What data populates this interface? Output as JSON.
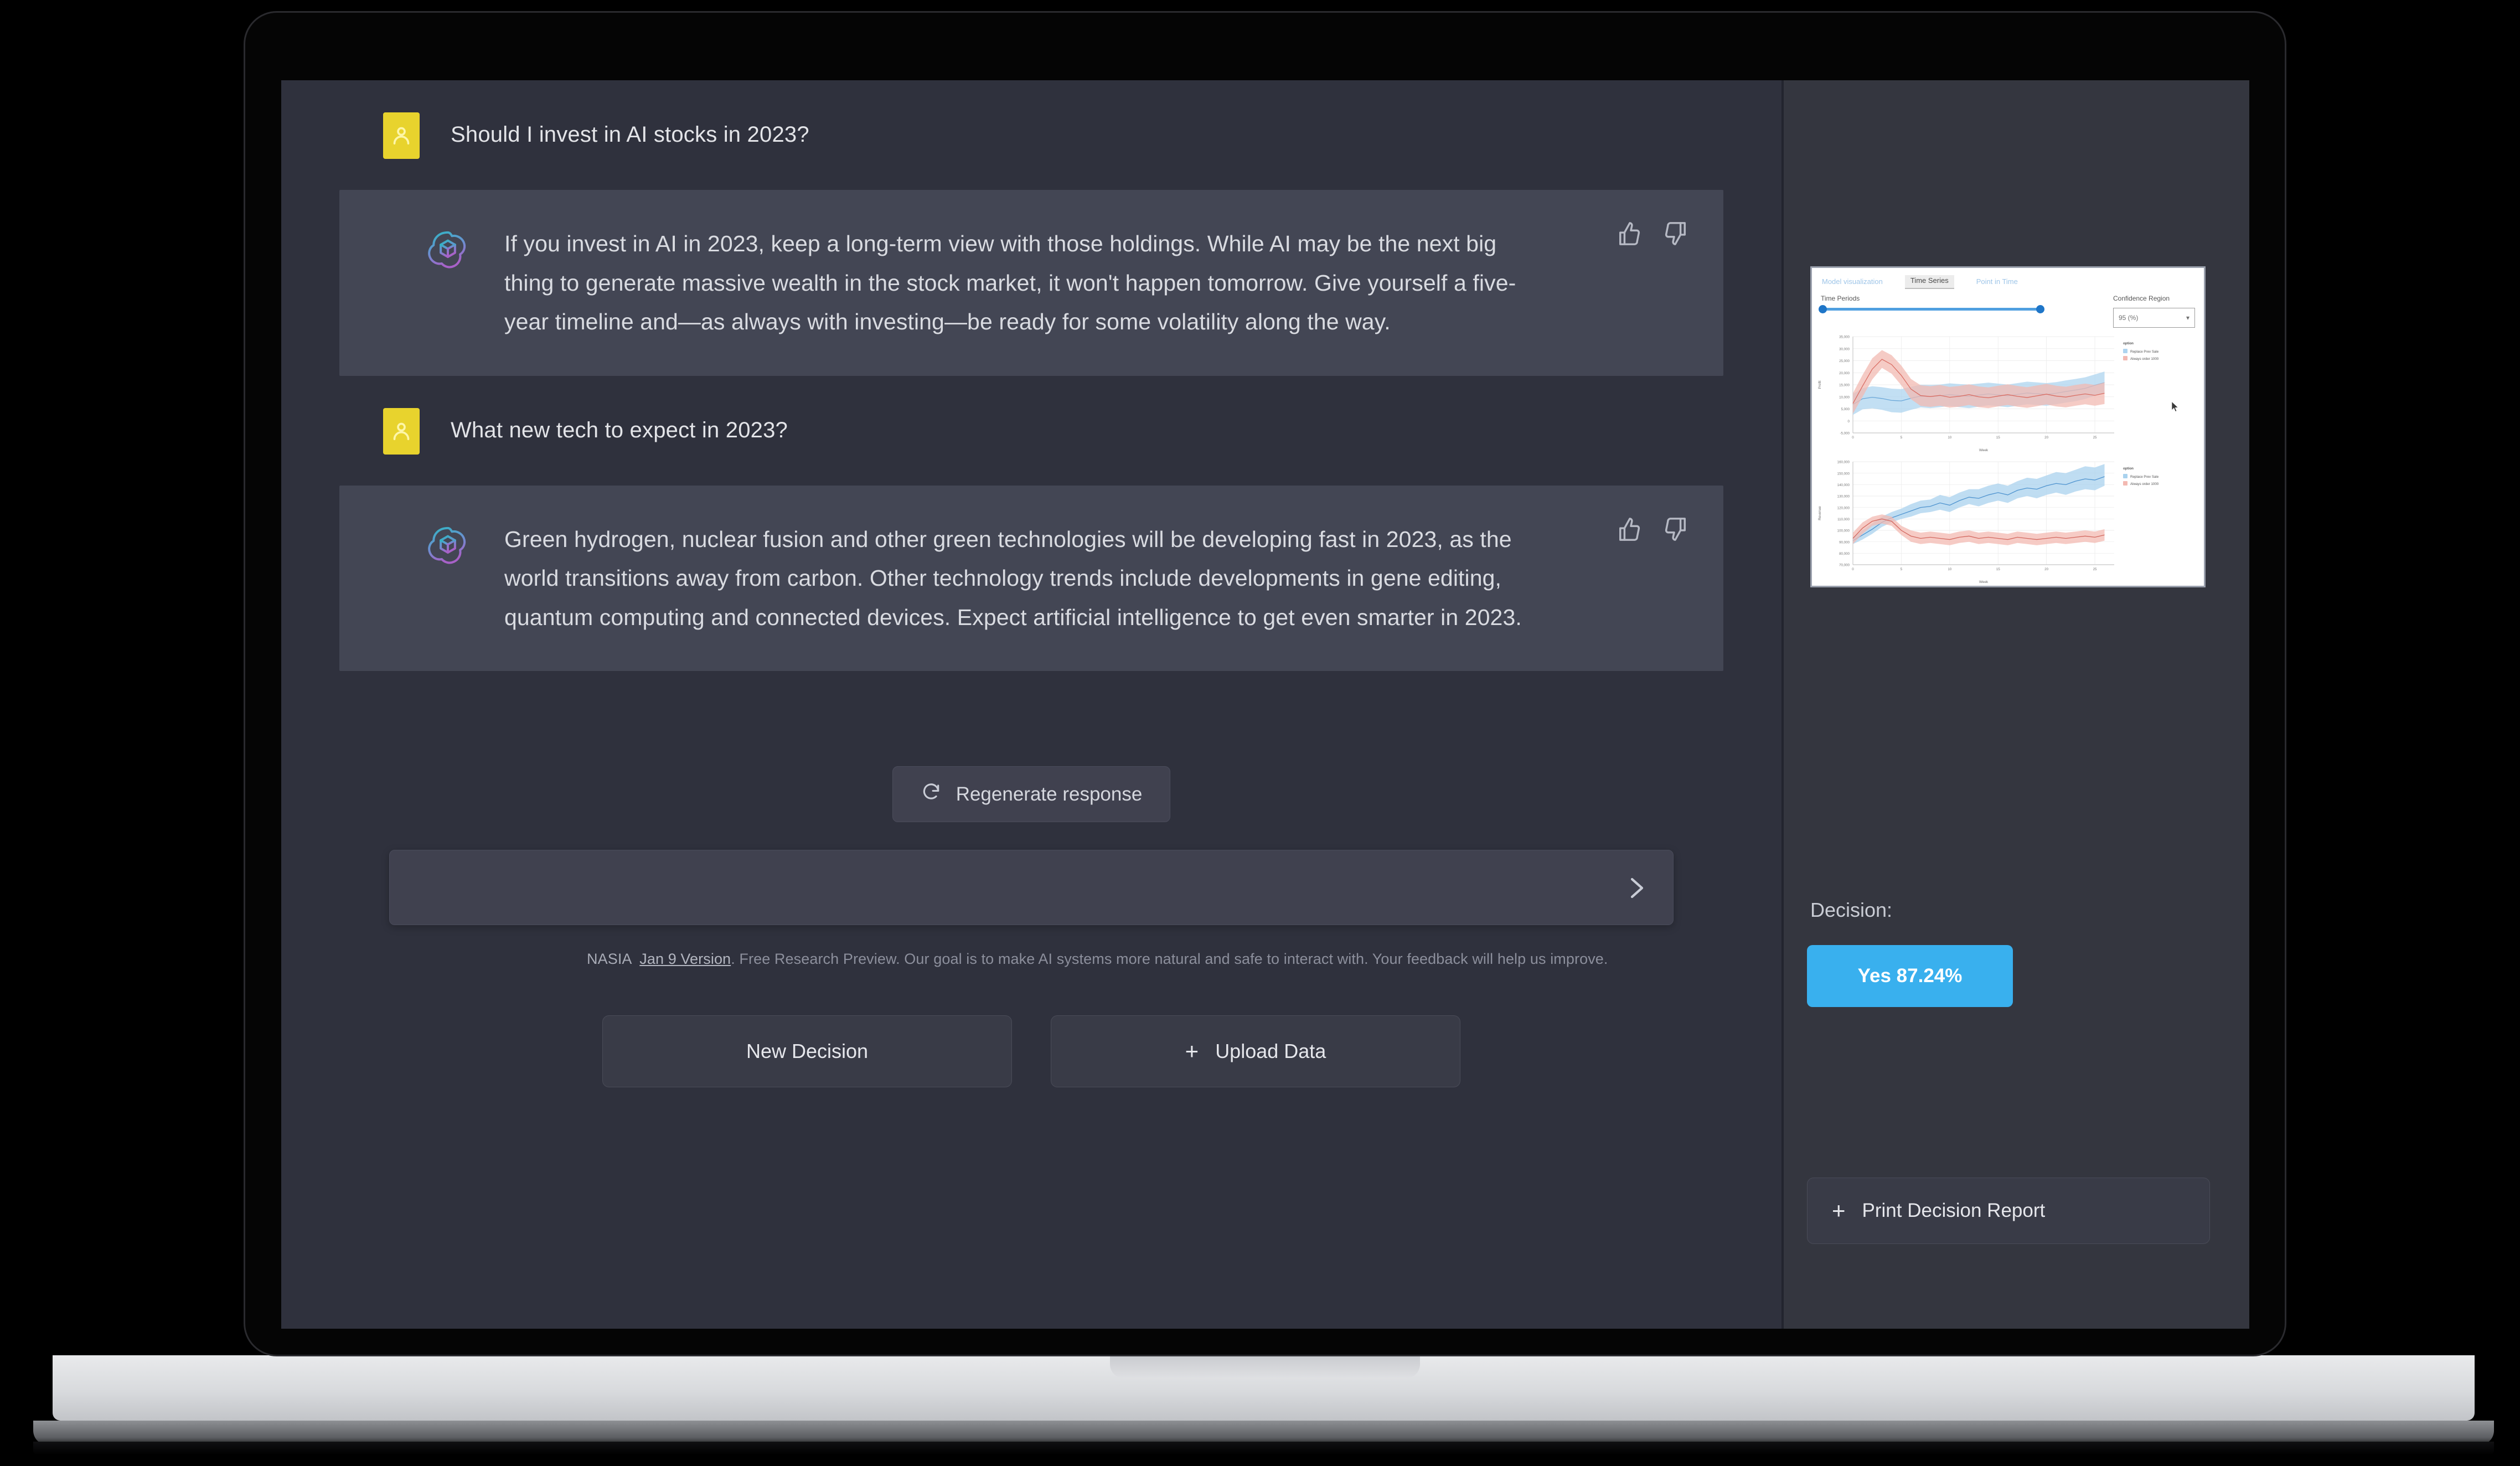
{
  "chat": {
    "messages": [
      {
        "role": "user",
        "avatar_icon": "person-icon",
        "text": "Should I invest in AI stocks in 2023?"
      },
      {
        "role": "assistant",
        "avatar_icon": "openai-logo-icon",
        "text": "If you invest in AI in 2023, keep a long-term view with those holdings. While AI may be the next big thing to generate massive wealth in the stock market, it won't happen tomorrow. Give yourself a five-year timeline and—as always with investing—be ready for some volatility along the way.",
        "thumbs_up_icon": "thumbs-up-icon",
        "thumbs_down_icon": "thumbs-down-icon"
      },
      {
        "role": "user",
        "avatar_icon": "person-icon",
        "text": "What new tech to expect in 2023?"
      },
      {
        "role": "assistant",
        "avatar_icon": "openai-logo-icon",
        "text": "Green hydrogen, nuclear fusion and other green technologies will be developing fast in 2023, as the world transitions away from carbon. Other technology trends include developments in gene editing, quantum computing and connected devices. Expect artificial intelligence to get even smarter in 2023.",
        "thumbs_up_icon": "thumbs-up-icon",
        "thumbs_down_icon": "thumbs-down-icon"
      }
    ],
    "regenerate_label": "Regenerate response",
    "regenerate_icon": "refresh-icon",
    "input_value": "",
    "input_placeholder": "",
    "send_icon": "send-icon"
  },
  "footer": {
    "brand": "NASIA",
    "version": "Jan 9 Version",
    "notice": ". Free Research Preview. Our goal is to make AI systems more natural and safe to interact with. Your feedback will help us improve."
  },
  "bottom_buttons": [
    {
      "label": "New Decision",
      "icon": ""
    },
    {
      "label": "Upload Data",
      "icon": "plus-icon"
    }
  ],
  "side_panel": {
    "viz": {
      "tabs": [
        {
          "label": "Model visualization",
          "active": false
        },
        {
          "label": "Time Series",
          "active": true
        },
        {
          "label": "Point in Time",
          "active": false
        }
      ],
      "time_periods_label": "Time Periods",
      "confidence_region_label": "Confidence Region",
      "confidence_region_value": "95 (%)",
      "dropdown_icon": "chevron-down-icon"
    },
    "decision_label": "Decision:",
    "decision_value": "Yes 87.24%",
    "decision_color": "#39b0ee",
    "print_report_label": "Print Decision Report",
    "print_report_icon": "plus-icon"
  },
  "chart_data": [
    {
      "type": "line",
      "title": "",
      "xlabel": "Week",
      "ylabel": "Profit",
      "xlim": [
        0,
        27
      ],
      "ylim": [
        -5000,
        35000
      ],
      "xticks": [
        0,
        5,
        10,
        15,
        20,
        25
      ],
      "yticks": [
        -5000,
        0,
        5000,
        10000,
        15000,
        20000,
        25000,
        30000,
        35000
      ],
      "ytick_labels": [
        "-5,000",
        "0",
        "5,000",
        "10,000",
        "15,000",
        "20,000",
        "25,000",
        "30,000",
        "35,000"
      ],
      "grid": true,
      "legend_title": "option",
      "legend_position": "right",
      "series": [
        {
          "name": "Replace Prev Sale",
          "color": "#6aa7d8",
          "band_color": "#aed4ef",
          "x": [
            0,
            1,
            2,
            3,
            4,
            5,
            6,
            7,
            8,
            9,
            10,
            11,
            12,
            13,
            14,
            15,
            16,
            17,
            18,
            19,
            20,
            21,
            22,
            23,
            24,
            25,
            26
          ],
          "values": [
            6800,
            9200,
            9800,
            9300,
            8500,
            8300,
            9400,
            10300,
            10100,
            10400,
            10900,
            10500,
            10200,
            10700,
            11200,
            10800,
            10400,
            11000,
            11600,
            11300,
            11000,
            11500,
            12200,
            12800,
            13500,
            14800,
            15900
          ],
          "band_low": [
            2500,
            4800,
            5200,
            4600,
            3600,
            3400,
            4600,
            5600,
            5300,
            5700,
            6200,
            5700,
            5300,
            5900,
            6500,
            6100,
            5700,
            6300,
            6900,
            6600,
            6300,
            6900,
            7600,
            8200,
            9100,
            10500,
            11600
          ],
          "band_high": [
            11200,
            13600,
            14400,
            14000,
            13400,
            13200,
            14200,
            15000,
            14900,
            15100,
            15600,
            15300,
            15100,
            15500,
            15900,
            15500,
            15100,
            15700,
            16300,
            16000,
            15700,
            16100,
            16800,
            17400,
            18100,
            19300,
            20500
          ]
        },
        {
          "name": "Always order 1000",
          "color": "#d96d63",
          "band_color": "#f2b9b2",
          "x": [
            0,
            1,
            2,
            3,
            4,
            5,
            6,
            7,
            8,
            9,
            10,
            11,
            12,
            13,
            14,
            15,
            16,
            17,
            18,
            19,
            20,
            21,
            22,
            23,
            24,
            25,
            26
          ],
          "values": [
            7200,
            14500,
            21500,
            25600,
            23400,
            18900,
            13200,
            10500,
            10100,
            10600,
            9800,
            10200,
            10900,
            10000,
            9600,
            10300,
            10900,
            10200,
            9700,
            10400,
            11100,
            10300,
            9900,
            10600,
            11200,
            10600,
            11500
          ],
          "band_low": [
            3000,
            10000,
            17200,
            22000,
            19600,
            14800,
            9000,
            6200,
            5800,
            6300,
            5500,
            5900,
            6600,
            5700,
            5300,
            6000,
            6600,
            5900,
            5400,
            6100,
            6800,
            6000,
            5600,
            6300,
            6900,
            6300,
            7000
          ],
          "band_high": [
            11500,
            19100,
            26000,
            29400,
            27300,
            23000,
            17400,
            14800,
            14400,
            14900,
            14100,
            14500,
            15200,
            14300,
            13900,
            14600,
            15200,
            14500,
            14000,
            14700,
            15400,
            14600,
            14200,
            14900,
            15500,
            14900,
            16000
          ]
        }
      ]
    },
    {
      "type": "line",
      "title": "",
      "xlabel": "Week",
      "ylabel": "Revenue",
      "xlim": [
        0,
        27
      ],
      "ylim": [
        70000,
        160000
      ],
      "xticks": [
        0,
        5,
        10,
        15,
        20,
        25
      ],
      "yticks": [
        70000,
        80000,
        90000,
        100000,
        110000,
        120000,
        130000,
        140000,
        150000,
        160000
      ],
      "ytick_labels": [
        "70,000",
        "80,000",
        "90,000",
        "100,000",
        "110,000",
        "120,000",
        "130,000",
        "140,000",
        "150,000",
        "160,000"
      ],
      "grid": true,
      "legend_title": "option",
      "legend_position": "right",
      "series": [
        {
          "name": "Replace Prev Sale",
          "color": "#4e93cf",
          "band_color": "#a9d2ee",
          "x": [
            0,
            1,
            2,
            3,
            4,
            5,
            6,
            7,
            8,
            9,
            10,
            11,
            12,
            13,
            14,
            15,
            16,
            17,
            18,
            19,
            20,
            21,
            22,
            23,
            24,
            25,
            26
          ],
          "values": [
            91000,
            96000,
            101000,
            107000,
            111000,
            114000,
            117000,
            120000,
            121000,
            124000,
            122000,
            126000,
            129000,
            128000,
            131000,
            133000,
            131000,
            135000,
            137000,
            136000,
            139000,
            141000,
            140000,
            143000,
            145000,
            144000,
            147000
          ],
          "band_low": [
            88000,
            92000,
            97000,
            103000,
            107000,
            110000,
            112000,
            115000,
            116000,
            118000,
            116000,
            120000,
            123000,
            121000,
            124000,
            126000,
            124000,
            128000,
            130000,
            128000,
            131000,
            133000,
            131000,
            134000,
            136000,
            135000,
            139000
          ],
          "band_high": [
            94000,
            100000,
            106000,
            112000,
            116000,
            119000,
            123000,
            126000,
            127000,
            131000,
            129000,
            133000,
            136000,
            136000,
            139000,
            141000,
            139000,
            143000,
            146000,
            145000,
            148000,
            151000,
            150000,
            153000,
            156000,
            155000,
            158000
          ]
        },
        {
          "name": "Always order 1000",
          "color": "#d2685f",
          "band_color": "#f3b9b2",
          "x": [
            0,
            1,
            2,
            3,
            4,
            5,
            6,
            7,
            8,
            9,
            10,
            11,
            12,
            13,
            14,
            15,
            16,
            17,
            18,
            19,
            20,
            21,
            22,
            23,
            24,
            25,
            26
          ],
          "values": [
            93000,
            102000,
            108000,
            110000,
            108000,
            100000,
            95000,
            93000,
            94000,
            93000,
            92000,
            94000,
            95000,
            93000,
            94000,
            93000,
            92000,
            94000,
            93000,
            92000,
            93000,
            94000,
            93000,
            94000,
            95000,
            94000,
            96000
          ],
          "band_low": [
            88000,
            97000,
            104000,
            106000,
            104000,
            96000,
            90000,
            88000,
            89000,
            88000,
            87000,
            89000,
            90000,
            88000,
            89000,
            88000,
            87000,
            89000,
            88000,
            87000,
            88000,
            89000,
            88000,
            89000,
            90000,
            89000,
            91000
          ],
          "band_high": [
            98000,
            107000,
            112000,
            114000,
            112000,
            104000,
            100000,
            98000,
            99000,
            98000,
            97000,
            99000,
            100000,
            98000,
            99000,
            98000,
            97000,
            99000,
            98000,
            97000,
            98000,
            99000,
            98000,
            99000,
            100000,
            99000,
            101000
          ]
        }
      ]
    }
  ]
}
